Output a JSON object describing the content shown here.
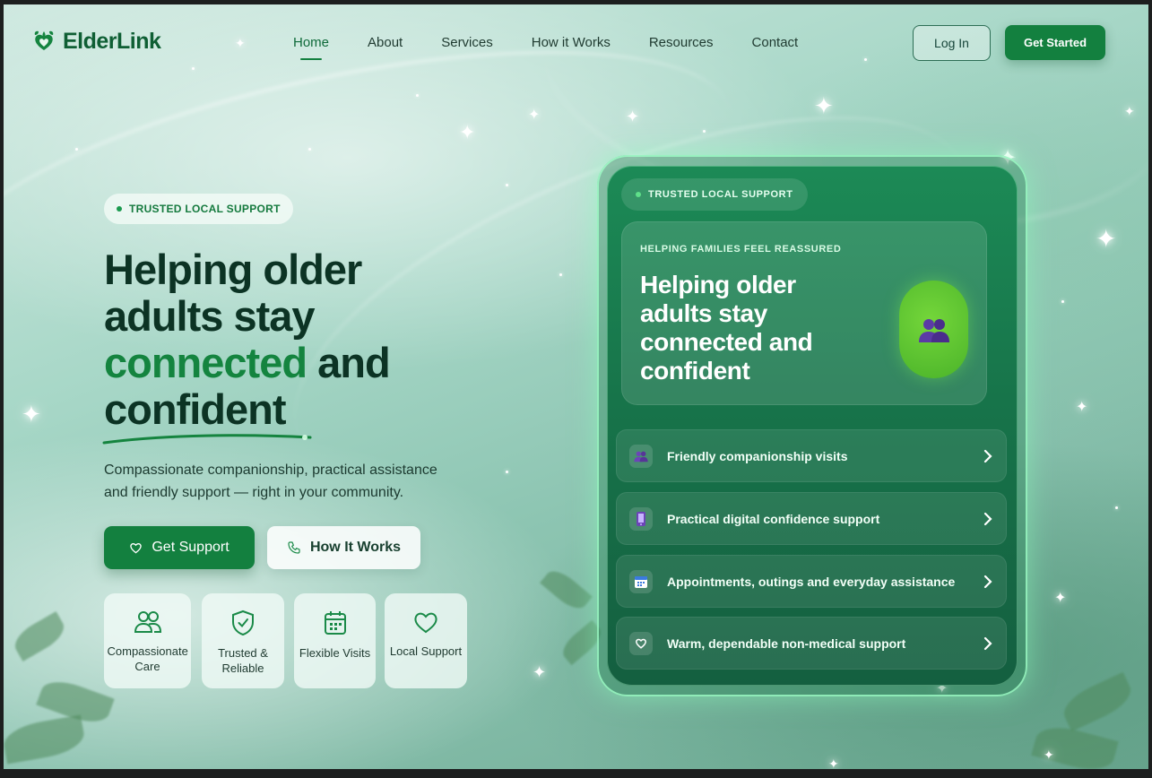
{
  "brand": {
    "name": "ElderLink"
  },
  "nav": {
    "links": [
      {
        "label": "Home",
        "active": true
      },
      {
        "label": "About"
      },
      {
        "label": "Services"
      },
      {
        "label": "How it Works"
      },
      {
        "label": "Resources"
      },
      {
        "label": "Contact"
      }
    ],
    "login_label": "Log In",
    "start_label": "Get Started"
  },
  "hero": {
    "badge": "TRUSTED LOCAL SUPPORT",
    "headline_line1": "Helping older",
    "headline_line2": "adults stay",
    "headline_highlight": "connected",
    "headline_and": " and",
    "headline_line4": "confident",
    "subtext": "Compassionate companionship, practical assistance and friendly support — right in your community.",
    "primary_button": "Get Support",
    "secondary_button": "How It Works",
    "features": [
      {
        "label": "Compassionate Care",
        "icon": "people-icon"
      },
      {
        "label": "Trusted & Reliable",
        "icon": "shield-check-icon"
      },
      {
        "label": "Flexible Visits",
        "icon": "calendar-icon"
      },
      {
        "label": "Local Support",
        "icon": "heart-icon"
      }
    ]
  },
  "card": {
    "badge": "TRUSTED LOCAL SUPPORT",
    "eyebrow": "HELPING FAMILIES FEEL REASSURED",
    "title": "Helping older adults stay connected and confident",
    "items": [
      {
        "label": "Friendly companionship visits",
        "icon": "people-emoji-icon"
      },
      {
        "label": "Practical digital confidence support",
        "icon": "phone-emoji-icon"
      },
      {
        "label": "Appointments, outings and everyday assistance",
        "icon": "calendar-emoji-icon"
      },
      {
        "label": "Warm, dependable non-medical support",
        "icon": "heart-icon"
      }
    ]
  },
  "colors": {
    "brand_green": "#13803f",
    "dark_text": "#0c3324",
    "card_green": "#17744a",
    "avatar_green": "#5cc232"
  }
}
